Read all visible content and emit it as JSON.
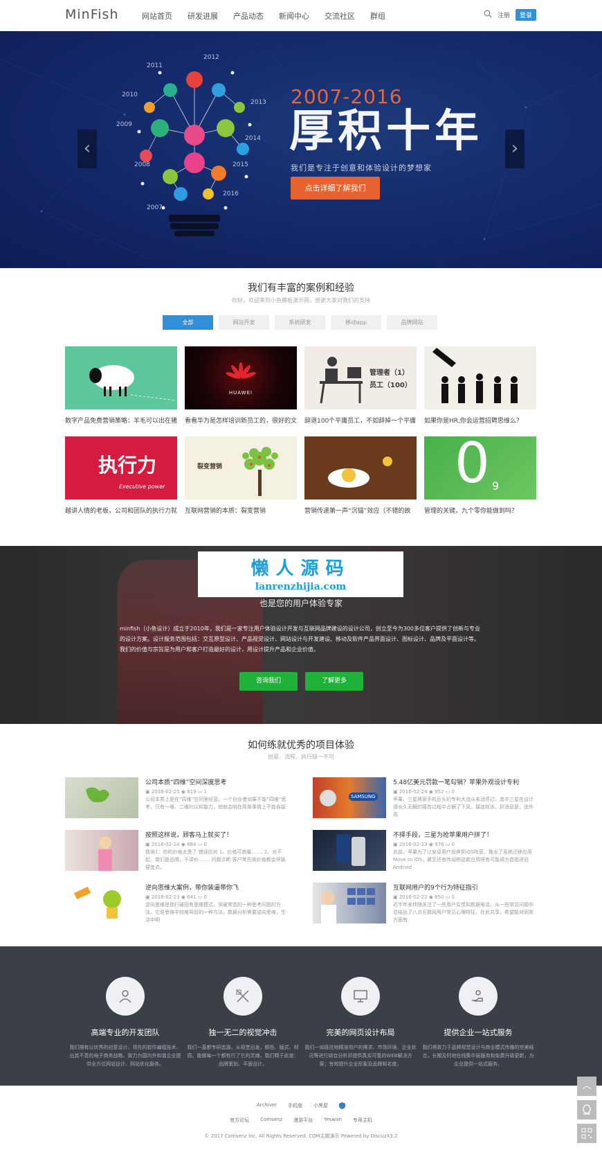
{
  "header": {
    "logo": "MinFish",
    "nav": [
      "网站首页",
      "研发进展",
      "产品动态",
      "新闻中心",
      "交流社区",
      "群组"
    ],
    "register": "注册",
    "login": "登录"
  },
  "banner": {
    "years": "2007-2016",
    "title": "厚积十年",
    "subtitle": "我们是专注于创意和体验设计的梦想家",
    "button": "点击详细了解我们",
    "bulb_years": [
      "2011",
      "2012",
      "2010",
      "2013",
      "2009",
      "2014",
      "2008",
      "2015",
      "2007",
      "2016"
    ]
  },
  "cases": {
    "title": "我们有丰富的案例和经验",
    "subtitle": "你好，欢迎来到小鱼模板演示网，感谢大家对我们的支持",
    "filters": [
      "全部",
      "网站开发",
      "系统研发",
      "移动app",
      "品牌网站"
    ],
    "items": [
      {
        "caption": "数字产品免费营销策略：羊毛可以出在猪"
      },
      {
        "caption": "看看华为是怎样培训新员工的，很好的文",
        "thumb_text": "HUAWEI"
      },
      {
        "caption": "辞退100个平庸员工，不如辞掉一个平庸",
        "thumb_text": "管理者（1）",
        "thumb_text2": "员工（100）"
      },
      {
        "caption": "如果你是HR,你会运营招聘思维么？"
      },
      {
        "caption": "越讲人情的老板，公司和团队的执行力就",
        "thumb_text": "执行力",
        "thumb_text2": "Executive power"
      },
      {
        "caption": "互联网营销的本质：裂变营销",
        "thumb_text": "裂变营销"
      },
      {
        "caption": "营销传递第一声“沉锚”效应（不错的故"
      },
      {
        "caption": "管理的关键，九个零你能做到吗？",
        "thumb_text": "0",
        "thumb_text2": "9"
      }
    ]
  },
  "about": {
    "watermark_cn": "懒人源码",
    "watermark_en": "lanrenzhijia.com",
    "subtitle": "也是您的用户体验专家",
    "text": "minfish（小鱼设计）成立于2010年，我们是一家专注用户体验设计开发与互联网品牌建设的设计公司，创立至今为300多位客户提供了创新与专业的设计方案。设计服务范围包括：交互原型设计、产品视觉设计、网站设计与开发建设、移动及软件产品界面设计、图标设计、品牌及平面设计等。我们的价值与宗旨是为用户和客户打造最好的设计，用设计提升产品和企业价值。",
    "btn_consult": "咨询我们",
    "btn_more": "了解更多"
  },
  "experience": {
    "title": "如何练就优秀的项目体验",
    "subtitle": "创意、流程、执行缺一不可",
    "articles": [
      {
        "title": "公司本质“四维”空间深度思考",
        "date": "2016-02-25",
        "views": "819",
        "comments": "1",
        "desc": "公司本质上是在“四维”空间里经营。一个创业者如果不能“四维”思考，只有一维、二维的认知能力，他就会陷在简单事情上不能自拔"
      },
      {
        "title": "5.48亿美元罚款一笔勾销？苹果外观设计专利",
        "date": "2016-02-24",
        "views": "952",
        "comments": "0",
        "desc": "苹果、三星两家手机巨头的专利大战从未消停过，其中三星在设计感长久无解的痛苦过程中占据了下风，接连败诉。好消息是，由外观",
        "thumb_text": "SAMSUNG"
      },
      {
        "title": "按照这样说，顾客马上就买了！",
        "date": "2016-02-24",
        "views": "684",
        "comments": "0",
        "desc": "情境1：你的价格太贵了 错误应对 1、价格可商量……. 2、对不起，我们是品牌，不讲价……. 问题诊断 客户常先挑价格都会佯装便宜点，"
      },
      {
        "title": "不择手段，三星为抢苹果用户拼了！",
        "date": "2016-02-23",
        "views": "976",
        "comments": "0",
        "desc": "此前，苹果为了让安卓用户投奔到iOS阵营，推出了系统迁移应用Move to iOS，甚至还有传闻称这款应用将有可能成为首批进驻Android"
      },
      {
        "title": "逆向思维大案例，带你装逼带你飞",
        "date": "2016-02-23",
        "views": "641",
        "comments": "0",
        "desc": "逆向思维是指打破固有思维模式，突破常态的一种思考问题的方法。它是思维中较难驾驭的一种方法，数据分析需要逆向思维，生活中明"
      },
      {
        "title": "互联网用户的9个行为特征指引",
        "date": "2016-02-22",
        "views": "650",
        "comments": "0",
        "desc": "近半年来伴随关注了一些用户反馈和数据电话，从一些常见问题中总结出了八点互联网用户常见心理特征，在此共享，希望能对同类方面有"
      }
    ]
  },
  "features": [
    {
      "title": "高端专业的开发团队",
      "desc": "我们拥有以优秀的创意设计、领先的软件编程技术、出其不意的电子商务战略，致力为国内外和谐企业提供全方位网站设计、网站优化服务。",
      "icon": "team-icon"
    },
    {
      "title": "独一无二的视觉冲击",
      "desc": "我们一直都专研追源，从视觉出发，颜色、版式、材质。能做每一个都有行了它的灵魂，我们精于此道：品牌策划、平面设计。",
      "icon": "design-tools-icon"
    },
    {
      "title": "完美的网页设计布局",
      "desc": "我们一如既往地精准用户的需求、市场环境、企业状况等进行综合分析并提供真实可靠的WEB解决方案；有效提升企业形象及品牌知名度。",
      "icon": "monitor-icon"
    },
    {
      "title": "提供企业一站式服务",
      "desc": "我们将致力于品牌视觉设计与商业模式传播的完美结合，长期及时地在线集中层服务和免费升级更新，为企业提供一站式服务。",
      "icon": "service-icon"
    }
  ],
  "footer": {
    "row1": [
      "Archiver",
      "手机版",
      "小黑屋"
    ],
    "row2": [
      "官方论坛",
      "Comsenz",
      "漫游平台",
      "Yeswan",
      "专用主机"
    ],
    "copyright": "© 2017 Comsenz Inc. All Rights Reserved. COM主题演示    Powered by DiscuzX3.2"
  },
  "colors": {
    "accent_blue": "#2f8fd7",
    "banner_orange": "#e8622f",
    "green": "#20b13a",
    "dark_panel": "#3b3f46"
  }
}
